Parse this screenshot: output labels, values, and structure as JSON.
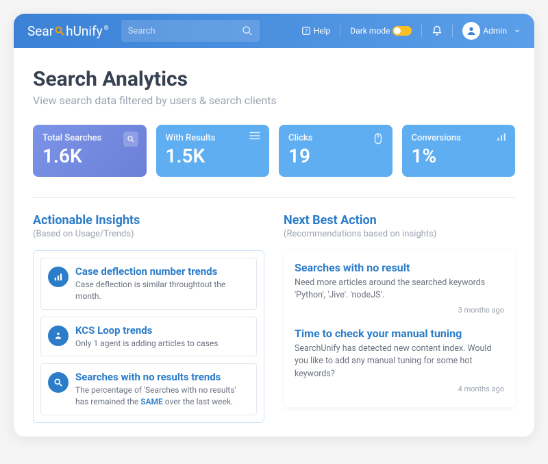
{
  "header": {
    "logo_pre": "Sear",
    "logo_mid": "h",
    "logo_post": "Unify",
    "search_placeholder": "Search",
    "help_label": "Help",
    "darkmode_label": "Dark mode",
    "admin_label": "Admin"
  },
  "page": {
    "title": "Search Analytics",
    "subtitle": "View search data filtered by users & search clients"
  },
  "stats": [
    {
      "label": "Total Searches",
      "value": "1.6K"
    },
    {
      "label": "With Results",
      "value": "1.5K"
    },
    {
      "label": "Clicks",
      "value": "19"
    },
    {
      "label": "Conversions",
      "value": "1%"
    }
  ],
  "insights": {
    "title": "Actionable Insights",
    "subtitle": "(Based on Usage/Trends)",
    "items": [
      {
        "title": "Case deflection number trends",
        "desc": "Case deflection is similar throughtout the month."
      },
      {
        "title": "KCS Loop trends",
        "desc": "Only 1 agent is adding articles to cases"
      },
      {
        "title": "Searches with no results trends",
        "desc_pre": "The percentage of 'Searches with no results' has remained the ",
        "desc_em": "SAME",
        "desc_post": " over the last week."
      }
    ]
  },
  "actions": {
    "title": "Next Best Action",
    "subtitle": "(Recommendations based on insights)",
    "items": [
      {
        "title": "Searches with no result",
        "desc": "Need more articles around the searched keywords 'Python', 'Jive'. 'nodeJS'.",
        "time": "3 months ago"
      },
      {
        "title": "Time to check your manual tuning",
        "desc": "SearchUnify has detected new content index. Would you like to add any manual tuning for some hot keywords?",
        "time": "4 months ago"
      }
    ]
  }
}
